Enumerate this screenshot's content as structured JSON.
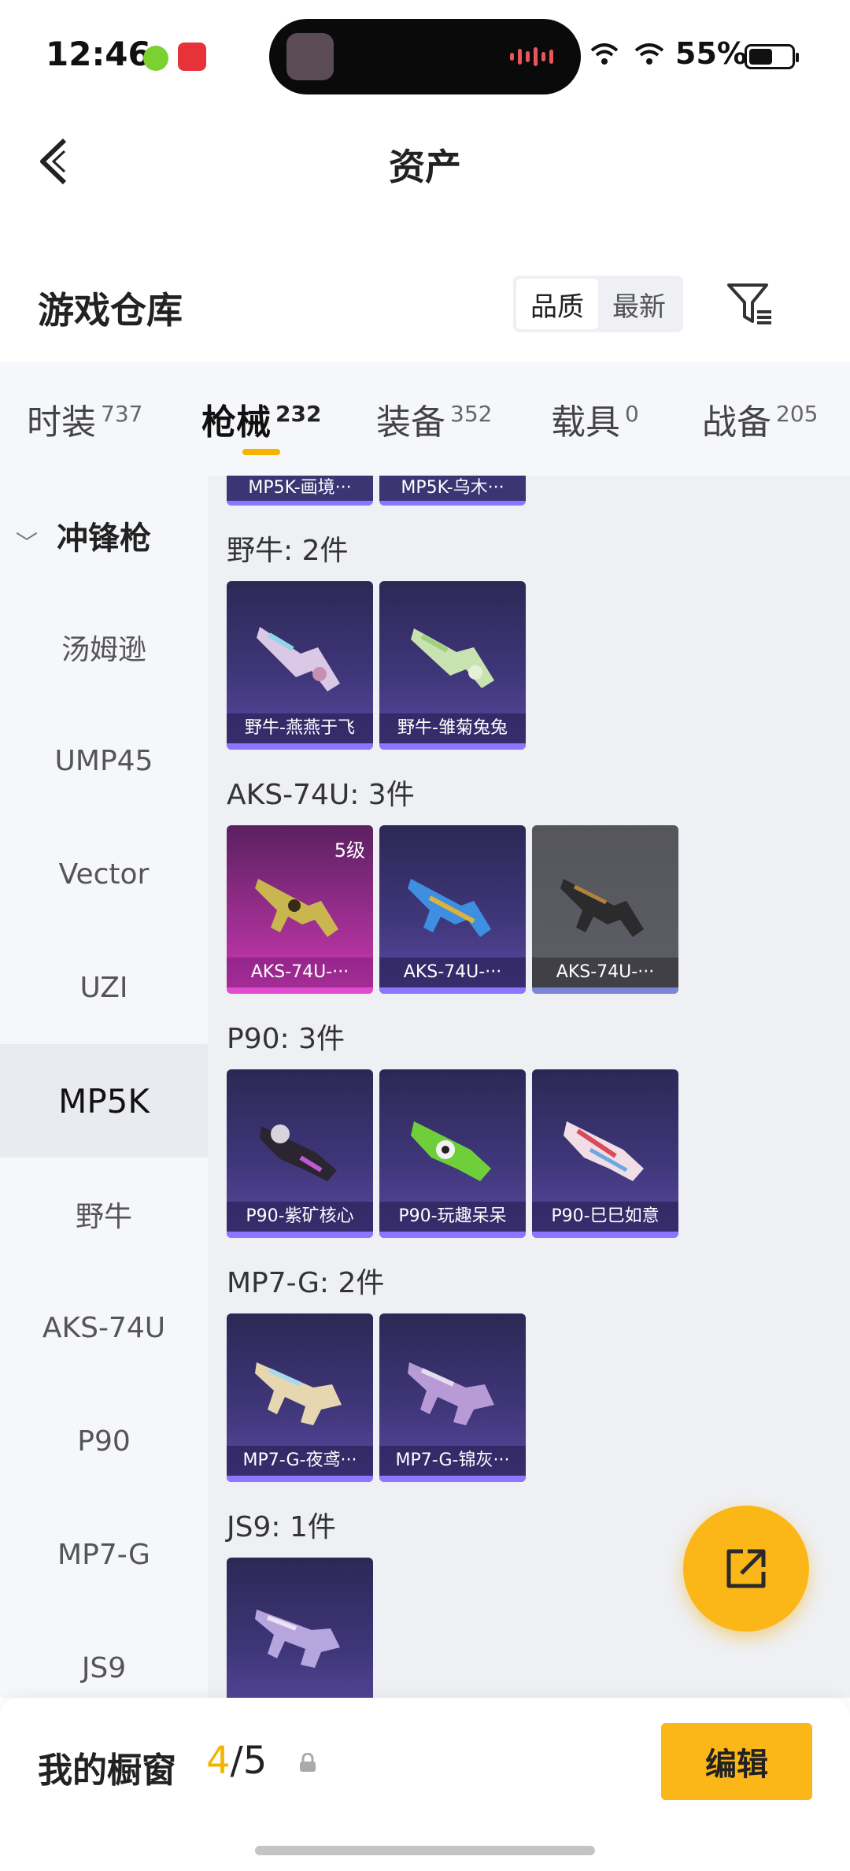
{
  "status": {
    "time": "12:46",
    "battery": "55%",
    "battery_level": 0.55
  },
  "header": {
    "title": "资产"
  },
  "warehouse": {
    "title": "游戏仓库",
    "sort_options": [
      "品质",
      "最新"
    ],
    "sort_selected": "品质"
  },
  "tabs": [
    {
      "label": "时装",
      "count": "737"
    },
    {
      "label": "枪械",
      "count": "232",
      "active": true
    },
    {
      "label": "装备",
      "count": "352"
    },
    {
      "label": "载具",
      "count": "0"
    },
    {
      "label": "战备",
      "count": "205"
    }
  ],
  "sidebar": {
    "group": "冲锋枪",
    "items": [
      "汤姆逊",
      "UMP45",
      "Vector",
      "UZI",
      "MP5K",
      "野牛",
      "AKS-74U",
      "P90",
      "MP7-G",
      "JS9"
    ],
    "active": "MP5K"
  },
  "content": {
    "partial_items": [
      "MP5K-画境···",
      "MP5K-乌木···"
    ],
    "groups": [
      {
        "label": "野牛: 2件",
        "items": [
          {
            "name": "野牛-燕燕于飞",
            "rarity": "purple"
          },
          {
            "name": "野牛-雏菊兔兔",
            "rarity": "purple"
          }
        ]
      },
      {
        "label": "AKS-74U: 3件",
        "items": [
          {
            "name": "AKS-74U-···",
            "rarity": "pink",
            "level": "5级"
          },
          {
            "name": "AKS-74U-···",
            "rarity": "purple"
          },
          {
            "name": "AKS-74U-···",
            "rarity": "gray"
          }
        ]
      },
      {
        "label": "P90: 3件",
        "items": [
          {
            "name": "P90-紫矿核心",
            "rarity": "purple"
          },
          {
            "name": "P90-玩趣呆呆",
            "rarity": "purple"
          },
          {
            "name": "P90-巳巳如意",
            "rarity": "purple"
          }
        ]
      },
      {
        "label": "MP7-G: 2件",
        "items": [
          {
            "name": "MP7-G-夜鸢···",
            "rarity": "purple"
          },
          {
            "name": "MP7-G-锦灰···",
            "rarity": "purple"
          }
        ]
      },
      {
        "label": "JS9: 1件",
        "items": [
          {
            "name": "",
            "rarity": "purple"
          }
        ]
      }
    ]
  },
  "showcase": {
    "label": "我的橱窗",
    "current": "4",
    "separator": "/",
    "total": "5",
    "edit_label": "编辑"
  },
  "colors": {
    "accent": "#fbb617",
    "rarity_purple": "#8d76ff",
    "rarity_pink": "#e24cd0",
    "rarity_gray": "#7b86d6"
  }
}
